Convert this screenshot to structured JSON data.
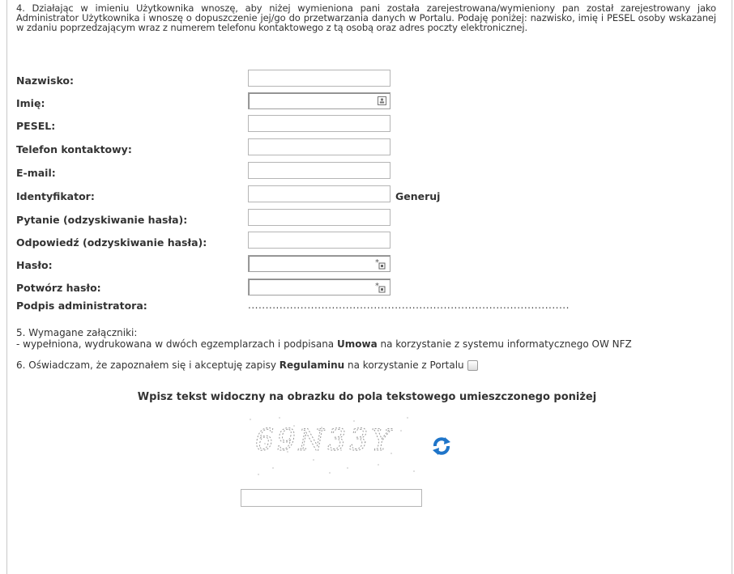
{
  "intro": "4. Działając w imieniu Użytkownika wnoszę, aby niżej wymieniona pani została zarejestrowana/wymieniony pan został zarejestrowany jako Administrator Użytkownika i wnoszę o dopuszczenie jej/go do przetwarzania danych w Portalu. Podaję poniżej: nazwisko, imię i PESEL osoby wskazanej w zdaniu poprzedzającym wraz z numerem telefonu kontaktowego z tą osobą oraz adres poczty elektronicznej.",
  "fields": {
    "nazwisko": "Nazwisko:",
    "imie": "Imię:",
    "pesel": "PESEL:",
    "telefon": "Telefon kontaktowy:",
    "email": "E-mail:",
    "identyfikator": "Identyfikator:",
    "pytanie": "Pytanie (odzyskiwanie hasła):",
    "odpowiedz": "Odpowiedź (odzyskiwanie hasła):",
    "haslo": "Hasło:",
    "potworz": "Potwórz hasło:",
    "podpis": "Podpis administratora:"
  },
  "generate_label": "Generuj",
  "signature_line": "............................................................................................",
  "attachments": {
    "heading": "5. Wymagane załączniki:",
    "item_prefix": "- wypełniona, wydrukowana w dwóch egzemplarzach i podpisana ",
    "item_bold": "Umowa",
    "item_suffix": " na korzystanie z systemu informatycznego OW NFZ"
  },
  "declaration": {
    "prefix": "6. Oświadczam, że zapoznałem się i akceptuję zapisy ",
    "bold": "Regulaminu",
    "suffix": " na korzystanie z Portalu"
  },
  "captcha": {
    "title": "Wpisz tekst widoczny na obrazku do pola tekstowego umieszczonego poniżej",
    "text": "69N33Y"
  }
}
